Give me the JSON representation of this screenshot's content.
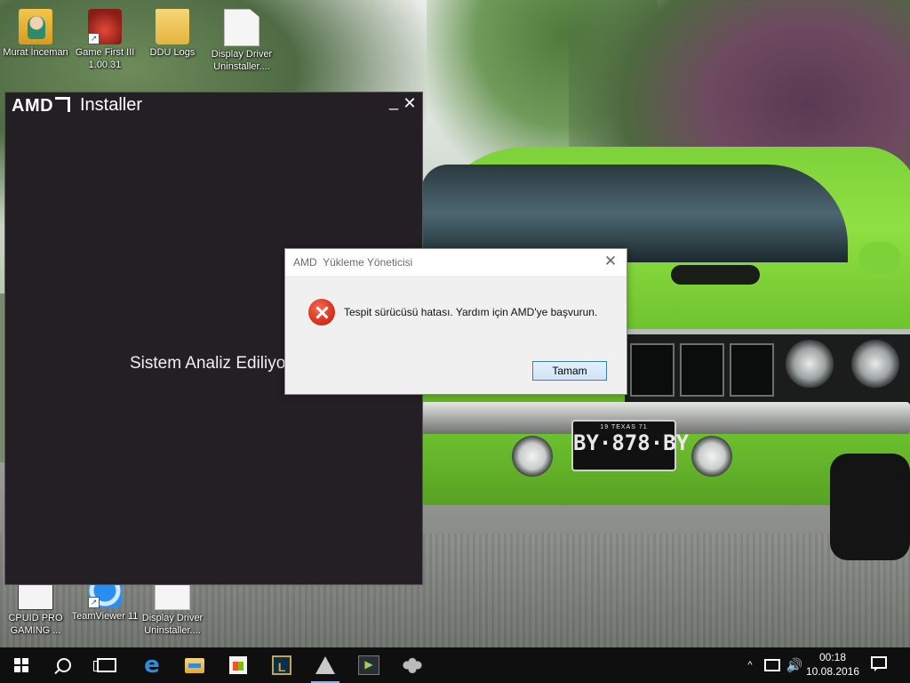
{
  "desktop": {
    "icons_top": [
      {
        "label": "Murat İnceman",
        "icon": "user-folder-icon"
      },
      {
        "label": "Game First III 1.00.31",
        "icon": "game-first-icon"
      },
      {
        "label": "DDU Logs",
        "icon": "folder-icon"
      },
      {
        "label": "Display Driver Uninstaller....",
        "icon": "document-icon"
      }
    ],
    "icons_bottom": [
      {
        "label": "CPUID PRO GAMING ...",
        "icon": "cpuid-icon"
      },
      {
        "label": "TeamViewer 11",
        "icon": "teamviewer-icon"
      },
      {
        "label": "Display Driver Uninstaller....",
        "icon": "document-icon"
      }
    ]
  },
  "wallpaper": {
    "plate_top": "19   TEXAS   71",
    "plate_main": "BY·878·BY"
  },
  "amd_installer": {
    "logo": "AMD",
    "title": "Installer",
    "minimize_glyph": "_",
    "close_glyph": "✕",
    "status": "Sistem Analiz Ediliyo"
  },
  "dialog": {
    "title": "AMD  Yükleme Yöneticisi",
    "close_glyph": "✕",
    "message": "Tespit sürücüsü hatası. Yardım için AMD'ye başvurun.",
    "ok_button": "Tamam",
    "icon": "error-icon"
  },
  "taskbar": {
    "apps": [
      "start-button",
      "search-icon",
      "task-view-icon",
      "edge-icon",
      "file-explorer-icon",
      "store-icon",
      "league-of-legends-icon",
      "amd-installer-icon",
      "steam-icon",
      "app-icon"
    ],
    "tray_chevron": "^",
    "volume_glyph": "🔊",
    "time": "00:18",
    "date": "10.08.2016"
  },
  "colors": {
    "installer_bg": "#231f24",
    "dialog_bg": "#f0f0f0",
    "button_border": "#3c7fb1",
    "error_red": "#d8341f",
    "taskbar_bg": "#0f0f10"
  }
}
